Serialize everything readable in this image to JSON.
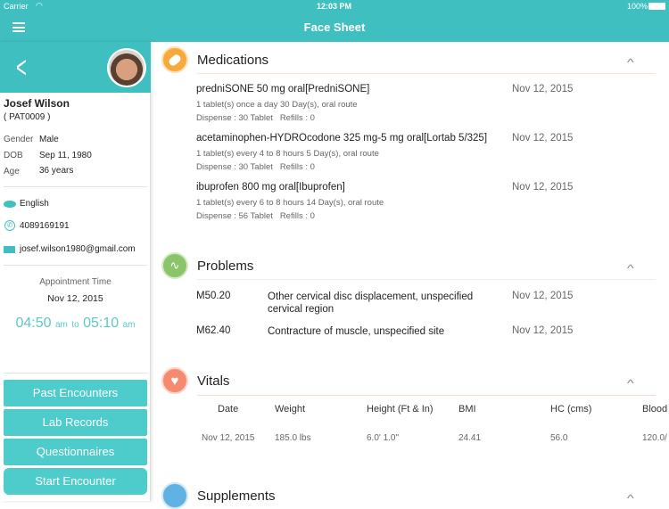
{
  "status_bar": {
    "carrier": "Carrier",
    "time": "12:03 PM",
    "battery": "100%"
  },
  "nav": {
    "title": "Face Sheet",
    "menu_icon": "hamburger-icon"
  },
  "patient": {
    "name": "Josef Wilson",
    "id": "( PAT0009 )",
    "fields": [
      {
        "label": "Gender",
        "value": "Male"
      },
      {
        "label": "DOB",
        "value": "Sep 11, 1980"
      },
      {
        "label": "Age",
        "value": "36 years"
      }
    ],
    "language": "English",
    "phone": "4089169191",
    "email": "josef.wilson1980@gmail.com"
  },
  "appointment": {
    "label": "Appointment Time",
    "date": "Nov 12, 2015",
    "start": "04:50",
    "start_ampm": "am",
    "to": "to",
    "end": "05:10",
    "end_ampm": "am"
  },
  "buttons": [
    "Past Encounters",
    "Lab Records",
    "Questionnaires",
    "Start Encounter"
  ],
  "medications": {
    "title": "Medications",
    "items": [
      {
        "name": "predniSONE 50 mg oral[PredniSONE]",
        "sig": "1 tablet(s) once a day 30 Day(s), oral route",
        "dispense": "Dispense : 30 Tablet   Refills : 0",
        "date": "Nov 12, 2015"
      },
      {
        "name": "acetaminophen-HYDROcodone 325 mg-5 mg oral[Lortab 5/325]",
        "sig": "1 tablet(s) every 4 to 8 hours 5 Day(s), oral route",
        "dispense": "Dispense : 30 Tablet   Refills : 0",
        "date": "Nov 12, 2015"
      },
      {
        "name": "ibuprofen 800 mg oral[Ibuprofen]",
        "sig": "1 tablet(s) every 6 to 8 hours 14 Day(s), oral route",
        "dispense": "Dispense : 56 Tablet   Refills : 0",
        "date": "Nov 12, 2015"
      }
    ]
  },
  "problems": {
    "title": "Problems",
    "items": [
      {
        "code": "M50.20",
        "desc": "Other cervical disc displacement, unspecified cervical region",
        "date": "Nov 12, 2015"
      },
      {
        "code": "M62.40",
        "desc": "Contracture of muscle, unspecified site",
        "date": "Nov 12, 2015"
      }
    ]
  },
  "vitals": {
    "title": "Vitals",
    "headers": [
      "Date",
      "Weight",
      "Height (Ft & In)",
      "BMI",
      "HC (cms)",
      "Blood"
    ],
    "rows": [
      [
        "Nov 12, 2015",
        "185.0 lbs",
        "6.0' 1.0\"",
        "24.41",
        "56.0",
        "120.0/"
      ]
    ]
  },
  "supplements": {
    "title": "Supplements"
  },
  "colors": {
    "teal": "#40bfc0",
    "button": "#4ecccc",
    "med": "#f7a93b",
    "problem": "#8cc46a",
    "vital": "#f58a6e",
    "supp": "#5fb2e3"
  }
}
